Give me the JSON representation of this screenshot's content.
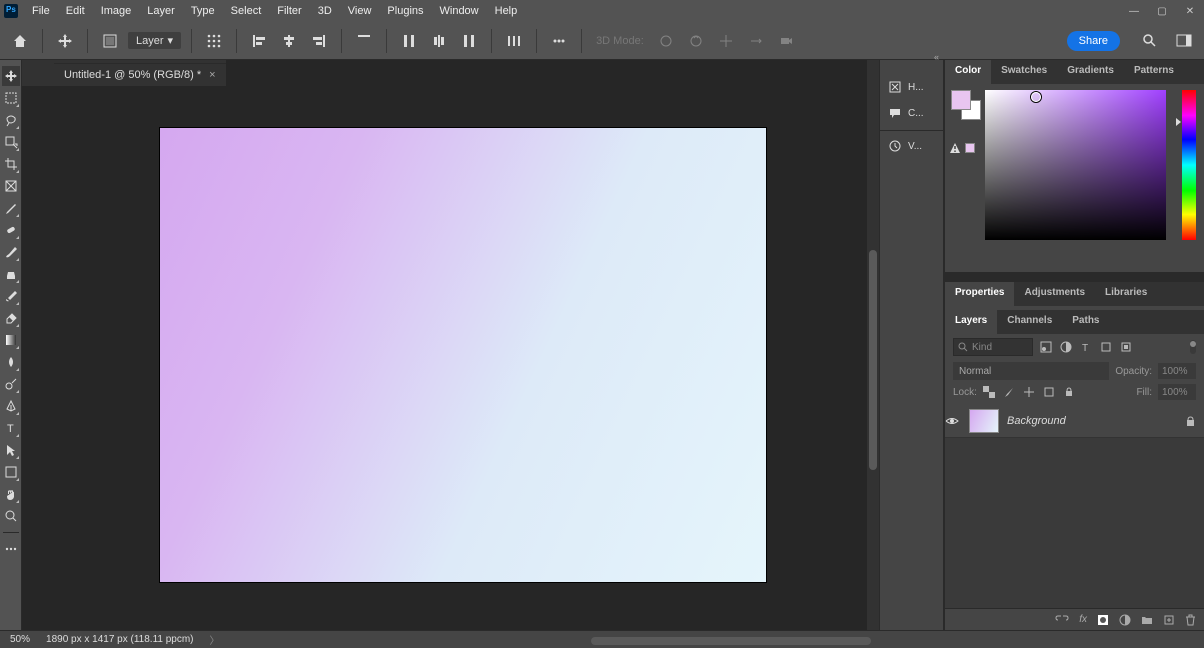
{
  "menu": [
    "File",
    "Edit",
    "Image",
    "Layer",
    "Type",
    "Select",
    "Filter",
    "3D",
    "View",
    "Plugins",
    "Window",
    "Help"
  ],
  "options_bar": {
    "layer_drop": "Layer",
    "mode_label": "3D Mode:"
  },
  "share_label": "Share",
  "doc_tab": "Untitled-1 @ 50% (RGB/8) *",
  "quick_panel": {
    "history": "H...",
    "comments": "C...",
    "version": "V..."
  },
  "color_tabs": [
    "Color",
    "Swatches",
    "Gradients",
    "Patterns"
  ],
  "props_tabs": [
    "Properties",
    "Adjustments",
    "Libraries"
  ],
  "layers_tabs": [
    "Layers",
    "Channels",
    "Paths"
  ],
  "layers": {
    "kind_placeholder": "Kind",
    "blend_mode": "Normal",
    "opacity_label": "Opacity:",
    "opacity_value": "100%",
    "lock_label": "Lock:",
    "fill_label": "Fill:",
    "fill_value": "100%",
    "bg_name": "Background"
  },
  "status": {
    "zoom": "50%",
    "doc_info": "1890 px x 1417 px (118.11 ppcm)"
  },
  "colors": {
    "foreground": "#e8c5f0",
    "background": "#ffffff"
  }
}
